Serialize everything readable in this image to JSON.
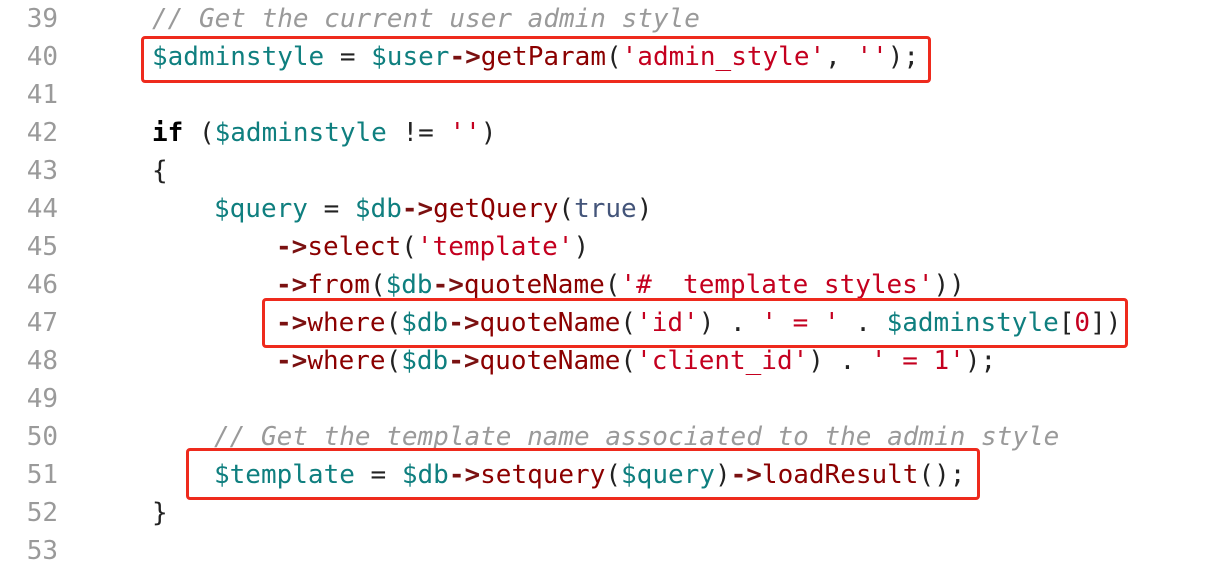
{
  "colors": {
    "comment": "#9a9a9a",
    "variable": "#0f7f7f",
    "operator": "#7a1111",
    "method": "#8b0000",
    "string": "#c4001f",
    "keyword": "#000000",
    "boolean": "#44557a",
    "number": "#c4001f",
    "punct": "#222222",
    "line_number": "#9a9a9a",
    "highlight": "#ee2a1d"
  },
  "lines": [
    {
      "num": "39",
      "indent": 0,
      "tokens": [
        {
          "t": "// Get the current user admin style",
          "c": "comment",
          "italic": true
        }
      ]
    },
    {
      "num": "40",
      "indent": 0,
      "tokens": [
        {
          "t": "$adminstyle",
          "c": "variable"
        },
        {
          "t": " = ",
          "c": "punct"
        },
        {
          "t": "$user",
          "c": "variable"
        },
        {
          "t": "->",
          "c": "operator",
          "bold": true
        },
        {
          "t": "getParam",
          "c": "method"
        },
        {
          "t": "(",
          "c": "punct"
        },
        {
          "t": "'admin_style'",
          "c": "string"
        },
        {
          "t": ", ",
          "c": "punct"
        },
        {
          "t": "''",
          "c": "string"
        },
        {
          "t": ");",
          "c": "punct"
        }
      ]
    },
    {
      "num": "41",
      "indent": 0,
      "tokens": []
    },
    {
      "num": "42",
      "indent": 0,
      "tokens": [
        {
          "t": "if",
          "c": "keyword",
          "bold": true
        },
        {
          "t": " (",
          "c": "punct"
        },
        {
          "t": "$adminstyle",
          "c": "variable"
        },
        {
          "t": " != ",
          "c": "punct"
        },
        {
          "t": "''",
          "c": "string"
        },
        {
          "t": ")",
          "c": "punct"
        }
      ]
    },
    {
      "num": "43",
      "indent": 0,
      "tokens": [
        {
          "t": "{",
          "c": "punct"
        }
      ]
    },
    {
      "num": "44",
      "indent": 1,
      "tokens": [
        {
          "t": "$query",
          "c": "variable"
        },
        {
          "t": " = ",
          "c": "punct"
        },
        {
          "t": "$db",
          "c": "variable"
        },
        {
          "t": "->",
          "c": "operator",
          "bold": true
        },
        {
          "t": "getQuery",
          "c": "method"
        },
        {
          "t": "(",
          "c": "punct"
        },
        {
          "t": "true",
          "c": "boolean"
        },
        {
          "t": ")",
          "c": "punct"
        }
      ]
    },
    {
      "num": "45",
      "indent": 2,
      "tokens": [
        {
          "t": "->",
          "c": "operator",
          "bold": true
        },
        {
          "t": "select",
          "c": "method"
        },
        {
          "t": "(",
          "c": "punct"
        },
        {
          "t": "'template'",
          "c": "string"
        },
        {
          "t": ")",
          "c": "punct"
        }
      ]
    },
    {
      "num": "46",
      "indent": 2,
      "tokens": [
        {
          "t": "->",
          "c": "operator",
          "bold": true
        },
        {
          "t": "from",
          "c": "method"
        },
        {
          "t": "(",
          "c": "punct"
        },
        {
          "t": "$db",
          "c": "variable"
        },
        {
          "t": "->",
          "c": "operator",
          "bold": true
        },
        {
          "t": "quoteName",
          "c": "method"
        },
        {
          "t": "(",
          "c": "punct"
        },
        {
          "t": "'#__template_styles'",
          "c": "string"
        },
        {
          "t": "))",
          "c": "punct"
        }
      ]
    },
    {
      "num": "47",
      "indent": 2,
      "tokens": [
        {
          "t": "->",
          "c": "operator",
          "bold": true
        },
        {
          "t": "where",
          "c": "method"
        },
        {
          "t": "(",
          "c": "punct"
        },
        {
          "t": "$db",
          "c": "variable"
        },
        {
          "t": "->",
          "c": "operator",
          "bold": true
        },
        {
          "t": "quoteName",
          "c": "method"
        },
        {
          "t": "(",
          "c": "punct"
        },
        {
          "t": "'id'",
          "c": "string"
        },
        {
          "t": ") . ",
          "c": "punct"
        },
        {
          "t": "' = '",
          "c": "string"
        },
        {
          "t": " . ",
          "c": "punct"
        },
        {
          "t": "$adminstyle",
          "c": "variable"
        },
        {
          "t": "[",
          "c": "punct"
        },
        {
          "t": "0",
          "c": "number"
        },
        {
          "t": "])",
          "c": "punct"
        }
      ]
    },
    {
      "num": "48",
      "indent": 2,
      "tokens": [
        {
          "t": "->",
          "c": "operator",
          "bold": true
        },
        {
          "t": "where",
          "c": "method"
        },
        {
          "t": "(",
          "c": "punct"
        },
        {
          "t": "$db",
          "c": "variable"
        },
        {
          "t": "->",
          "c": "operator",
          "bold": true
        },
        {
          "t": "quoteName",
          "c": "method"
        },
        {
          "t": "(",
          "c": "punct"
        },
        {
          "t": "'client_id'",
          "c": "string"
        },
        {
          "t": ") . ",
          "c": "punct"
        },
        {
          "t": "' = 1'",
          "c": "string"
        },
        {
          "t": ");",
          "c": "punct"
        }
      ]
    },
    {
      "num": "49",
      "indent": 0,
      "tokens": []
    },
    {
      "num": "50",
      "indent": 1,
      "tokens": [
        {
          "t": "// Get the template name associated to the admin style",
          "c": "comment",
          "italic": true
        }
      ]
    },
    {
      "num": "51",
      "indent": 1,
      "tokens": [
        {
          "t": "$template",
          "c": "variable"
        },
        {
          "t": " = ",
          "c": "punct"
        },
        {
          "t": "$db",
          "c": "variable"
        },
        {
          "t": "->",
          "c": "operator",
          "bold": true
        },
        {
          "t": "setquery",
          "c": "method"
        },
        {
          "t": "(",
          "c": "punct"
        },
        {
          "t": "$query",
          "c": "variable"
        },
        {
          "t": ")",
          "c": "punct"
        },
        {
          "t": "->",
          "c": "operator",
          "bold": true
        },
        {
          "t": "loadResult",
          "c": "method"
        },
        {
          "t": "();",
          "c": "punct"
        }
      ]
    },
    {
      "num": "52",
      "indent": 0,
      "tokens": [
        {
          "t": "}",
          "c": "punct"
        }
      ]
    },
    {
      "num": "53",
      "indent": 0,
      "tokens": []
    }
  ]
}
